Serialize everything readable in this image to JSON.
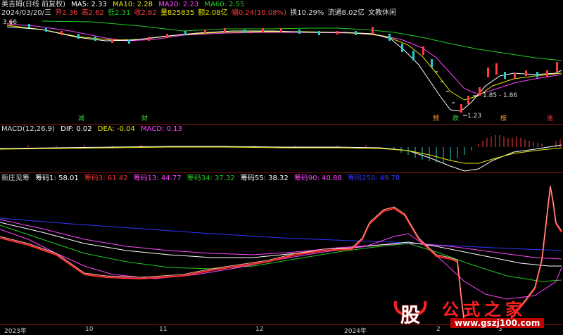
{
  "header": {
    "stock": "美吉姆(日线 前复权)",
    "ma5": "MA5: 2.33",
    "ma10": "MA10: 2.28",
    "ma20": "MA20: 2.23",
    "ma60": "MA60: 2.55",
    "date": "2024/03/20/三",
    "open": "开2.36",
    "high": "高2.62",
    "low": "低2.31",
    "close": "收2.62",
    "vol": "量825835",
    "amount": "额2.08亿",
    "change": "幅0.24(10.08%)",
    "turnover": "换10.29%",
    "float": "流通8.02亿",
    "sector": "文教休闲"
  },
  "price_annotations": {
    "high_label": "3.66",
    "range_label": "1.85 - 1.86",
    "low_label": "1.23"
  },
  "markers": [
    {
      "text": "减",
      "color": "#3cd33c"
    },
    {
      "text": "财",
      "color": "#3cd33c"
    },
    {
      "text": "预",
      "color": "#ff9a2e"
    },
    {
      "text": "跌",
      "color": "#3cd33c"
    },
    {
      "text": "榜",
      "color": "#ff9a2e"
    },
    {
      "text": "涨",
      "color": "#ff3c3c"
    }
  ],
  "macd": {
    "title": "MACD(12,26,9)",
    "dif": "DIF: 0.02",
    "dea": "DEA: -0.04",
    "macd": "MACD: 0.13"
  },
  "indicator": {
    "title": "新庄见筹",
    "c1": "筹码1: 58.01",
    "c3": "筹码3: 61.42",
    "c13": "筹码13: 44.77",
    "c34": "筹码34: 37.32",
    "c55": "筹码55: 38.32",
    "c90": "筹码90: 40.88",
    "c250": "筹码250: 49.78"
  },
  "xaxis": {
    "y2023": "2023年",
    "m10": "10",
    "m11": "11",
    "m12": "12",
    "y2024": "2024年",
    "m2": "2",
    "m3": "3"
  },
  "logo": {
    "mark": "股",
    "name": "公式之家",
    "url": "www.gszj100.com"
  },
  "colors": {
    "ma5": "#ffffff",
    "ma10": "#e6e600",
    "ma20": "#ff44ff",
    "ma60": "#22cc22",
    "up": "#ff3c3c",
    "down": "#22cccc",
    "panel_sep": "#7a1010",
    "c1": "#ffffff",
    "c3": "#ff3030",
    "c13": "#ff44ff",
    "c34": "#22cc22",
    "c55": "#ffffff",
    "c90": "#ff44ff",
    "c250": "#3333ff"
  }
}
